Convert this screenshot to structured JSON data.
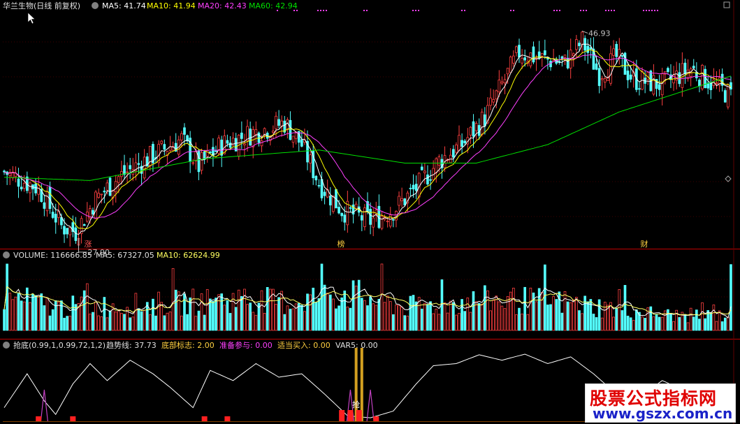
{
  "header": {
    "stock_title": "华兰生物(日线 前复权)",
    "ma5": "MA5: 41.74",
    "ma10": "MA10: 41.94",
    "ma20": "MA20: 42.43",
    "ma60": "MA60: 42.94"
  },
  "volume_header": {
    "volume": "VOLUME: 116666.85",
    "ma5": "MA5: 67327.05",
    "ma10": "MA10: 62624.99"
  },
  "indicator_header": {
    "name": "抢底(0.99,1,0.99,72,1,2)",
    "trend": "趋势线: 37.73",
    "bottom_flag": "底部标志: 2.00",
    "prepare": "准备参与: 0.00",
    "buy": "适当买入: 0.00",
    "var5": "VAR5: 0.00"
  },
  "annotations": {
    "high_price": "46.93",
    "low_price": "27.90",
    "marker_zhang": "涨",
    "marker_bang": "榜",
    "marker_cai": "财",
    "marker_qiang": "抢"
  },
  "watermark": {
    "line1": "股票公式指标网",
    "line2": "www.gszx.com.cn"
  },
  "colors": {
    "up": "#ff4040",
    "down": "#54ffff",
    "ma5": "#ffffff",
    "ma10": "#ffff00",
    "ma20": "#ff40ff",
    "ma60": "#00e000",
    "vol_ma10": "#ffff60",
    "trend": "#ffffff",
    "indicator_peak": "#d4a020",
    "flag_bar": "#ff2020",
    "grid": "#800000",
    "divider": "#c00000"
  },
  "chart_data": [
    {
      "type": "candlestick",
      "title": "华兰生物(日线 前复权)",
      "price_max": 46.93,
      "price_min": 27.9,
      "ylim": [
        27.0,
        48.5
      ],
      "key_points": [
        {
          "label": "46.93",
          "y": 46.93
        },
        {
          "label": "27.90",
          "y": 27.9
        }
      ],
      "close_path": [
        {
          "x": 0,
          "y": 34.0
        },
        {
          "x": 12,
          "y": 32.5
        },
        {
          "x": 20,
          "y": 29.0
        },
        {
          "x": 25,
          "y": 28.5
        },
        {
          "x": 32,
          "y": 31.5
        },
        {
          "x": 40,
          "y": 33.5
        },
        {
          "x": 52,
          "y": 35.5
        },
        {
          "x": 62,
          "y": 37.0
        },
        {
          "x": 68,
          "y": 34.5
        },
        {
          "x": 76,
          "y": 36.5
        },
        {
          "x": 86,
          "y": 37.5
        },
        {
          "x": 98,
          "y": 38.5
        },
        {
          "x": 104,
          "y": 36.5
        },
        {
          "x": 110,
          "y": 33.0
        },
        {
          "x": 118,
          "y": 30.5
        },
        {
          "x": 128,
          "y": 29.5
        },
        {
          "x": 136,
          "y": 30.5
        },
        {
          "x": 144,
          "y": 32.5
        },
        {
          "x": 152,
          "y": 35.0
        },
        {
          "x": 160,
          "y": 36.5
        },
        {
          "x": 168,
          "y": 39.0
        },
        {
          "x": 174,
          "y": 42.0
        },
        {
          "x": 180,
          "y": 45.0
        },
        {
          "x": 186,
          "y": 44.5
        },
        {
          "x": 196,
          "y": 44.0
        },
        {
          "x": 202,
          "y": 46.0
        },
        {
          "x": 208,
          "y": 43.0
        },
        {
          "x": 214,
          "y": 44.5
        },
        {
          "x": 220,
          "y": 42.5
        },
        {
          "x": 230,
          "y": 42.0
        },
        {
          "x": 240,
          "y": 43.5
        },
        {
          "x": 248,
          "y": 42.0
        },
        {
          "x": 254,
          "y": 41.0
        }
      ],
      "ma60_path": [
        {
          "x": 0,
          "y": 33.5
        },
        {
          "x": 30,
          "y": 33.2
        },
        {
          "x": 70,
          "y": 35.2
        },
        {
          "x": 110,
          "y": 36.0
        },
        {
          "x": 140,
          "y": 34.8
        },
        {
          "x": 165,
          "y": 34.8
        },
        {
          "x": 190,
          "y": 36.5
        },
        {
          "x": 215,
          "y": 39.5
        },
        {
          "x": 235,
          "y": 41.2
        },
        {
          "x": 254,
          "y": 42.8
        }
      ]
    },
    {
      "type": "bar",
      "title": "VOLUME",
      "latest": 116666.85,
      "ma5": 67327.05,
      "ma10": 62624.99,
      "ylim": [
        0,
        120000
      ],
      "profile": [
        {
          "x": 0,
          "y": 65000
        },
        {
          "x": 20,
          "y": 45000
        },
        {
          "x": 50,
          "y": 50000
        },
        {
          "x": 80,
          "y": 60000
        },
        {
          "x": 100,
          "y": 55000
        },
        {
          "x": 118,
          "y": 75000
        },
        {
          "x": 140,
          "y": 45000
        },
        {
          "x": 170,
          "y": 60000
        },
        {
          "x": 195,
          "y": 55000
        },
        {
          "x": 230,
          "y": 30000
        },
        {
          "x": 254,
          "y": 28000
        }
      ]
    },
    {
      "type": "line",
      "title": "抢底(0.99,1,0.99,72,1,2)",
      "ylim": [
        0,
        100
      ],
      "trend_latest": 37.73,
      "trend_path": [
        {
          "x": 0,
          "y": 20
        },
        {
          "x": 8,
          "y": 70
        },
        {
          "x": 14,
          "y": 30
        },
        {
          "x": 18,
          "y": 10
        },
        {
          "x": 24,
          "y": 55
        },
        {
          "x": 30,
          "y": 85
        },
        {
          "x": 36,
          "y": 60
        },
        {
          "x": 44,
          "y": 90
        },
        {
          "x": 52,
          "y": 70
        },
        {
          "x": 58,
          "y": 50
        },
        {
          "x": 66,
          "y": 20
        },
        {
          "x": 72,
          "y": 75
        },
        {
          "x": 80,
          "y": 60
        },
        {
          "x": 88,
          "y": 85
        },
        {
          "x": 96,
          "y": 65
        },
        {
          "x": 104,
          "y": 70
        },
        {
          "x": 112,
          "y": 40
        },
        {
          "x": 120,
          "y": 8
        },
        {
          "x": 128,
          "y": 5
        },
        {
          "x": 136,
          "y": 15
        },
        {
          "x": 144,
          "y": 55
        },
        {
          "x": 150,
          "y": 82
        },
        {
          "x": 158,
          "y": 85
        },
        {
          "x": 166,
          "y": 98
        },
        {
          "x": 174,
          "y": 90
        },
        {
          "x": 182,
          "y": 99
        },
        {
          "x": 190,
          "y": 85
        },
        {
          "x": 198,
          "y": 95
        },
        {
          "x": 206,
          "y": 70
        },
        {
          "x": 214,
          "y": 40
        },
        {
          "x": 222,
          "y": 35
        },
        {
          "x": 230,
          "y": 60
        },
        {
          "x": 238,
          "y": 45
        },
        {
          "x": 246,
          "y": 55
        },
        {
          "x": 254,
          "y": 38
        }
      ],
      "flag_positions": [
        12,
        24,
        70,
        78,
        118,
        121,
        124,
        130
      ],
      "peak_positions": [
        123,
        125
      ],
      "pulse_positions": [
        14,
        121,
        128
      ]
    }
  ]
}
